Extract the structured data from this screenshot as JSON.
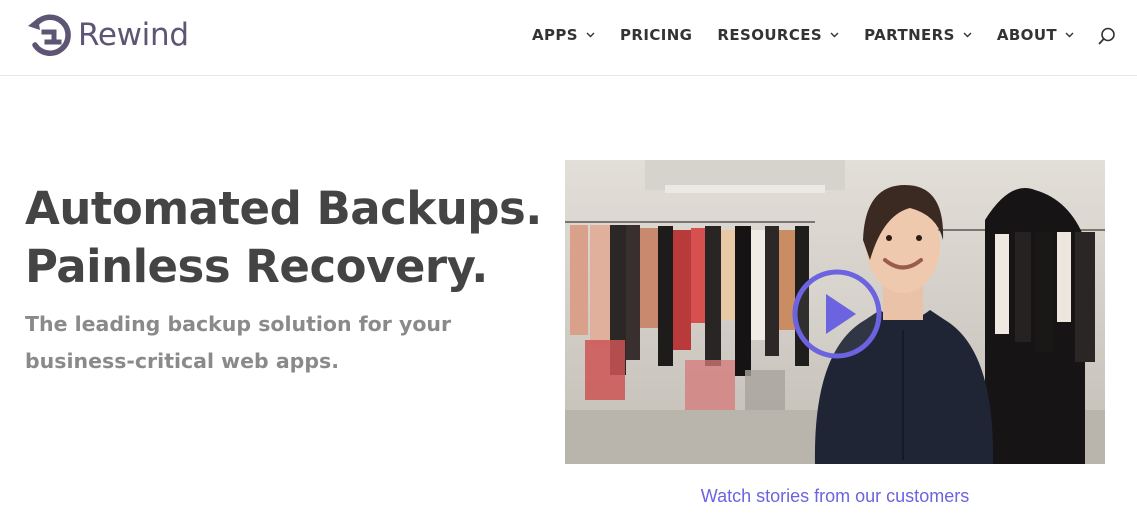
{
  "brand": {
    "name": "Rewind",
    "logo_color": "#5e5575"
  },
  "nav": {
    "items": [
      {
        "label": "APPS",
        "has_dropdown": true
      },
      {
        "label": "PRICING",
        "has_dropdown": false
      },
      {
        "label": "RESOURCES",
        "has_dropdown": true
      },
      {
        "label": "PARTNERS",
        "has_dropdown": true
      },
      {
        "label": "ABOUT",
        "has_dropdown": true
      }
    ],
    "search_icon": "search-icon"
  },
  "hero": {
    "headline_line1": "Automated Backups.",
    "headline_line2": "Painless Recovery.",
    "subheadline": "The leading backup solution for your business-critical web apps."
  },
  "video": {
    "play_icon": "play-circle-icon",
    "caption": "Watch stories from our customers"
  },
  "colors": {
    "accent": "#6c63e0",
    "headline": "#444444",
    "subtext": "#8a8a8a",
    "nav_text": "#333333"
  }
}
